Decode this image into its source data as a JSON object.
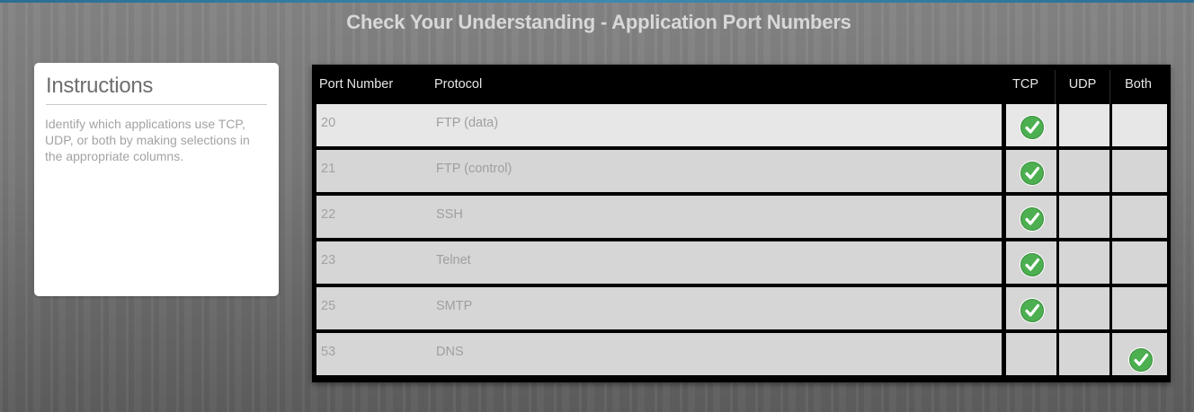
{
  "page": {
    "title": "Check Your Understanding - Application Port Numbers"
  },
  "instructions": {
    "heading": "Instructions",
    "text": "Identify which applications use TCP, UDP, or both by making selections in the appropriate columns."
  },
  "table": {
    "headers": {
      "port": "Port Number",
      "protocol": "Protocol",
      "tcp": "TCP",
      "udp": "UDP",
      "both": "Both"
    },
    "rows": [
      {
        "port": "20",
        "protocol": "FTP (data)",
        "selected": "tcp"
      },
      {
        "port": "21",
        "protocol": "FTP (control)",
        "selected": "tcp"
      },
      {
        "port": "22",
        "protocol": "SSH",
        "selected": "tcp"
      },
      {
        "port": "23",
        "protocol": "Telnet",
        "selected": "tcp"
      },
      {
        "port": "25",
        "protocol": "SMTP",
        "selected": "tcp"
      },
      {
        "port": "53",
        "protocol": "DNS",
        "selected": "both"
      }
    ],
    "check_icon": "check-circle-icon"
  },
  "colors": {
    "accent_strip": "#2a6f93",
    "header_bg": "#000000",
    "row_bg_light": "#e7e7e7",
    "row_bg": "#d6d6d6",
    "check_green": "#4caf50"
  }
}
